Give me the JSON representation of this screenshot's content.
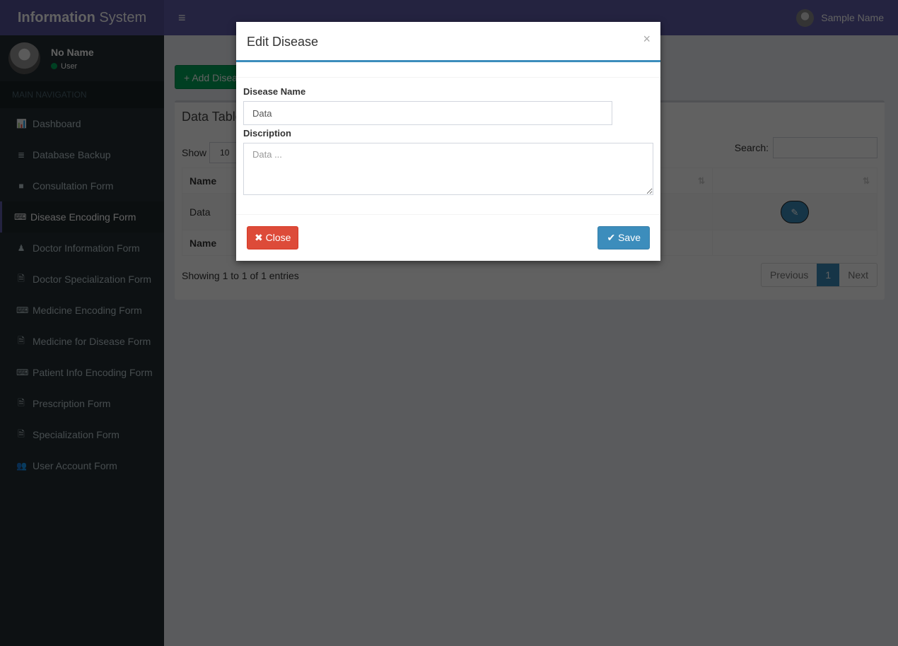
{
  "header": {
    "logo_bold": "Information",
    "logo_rest": " System",
    "toggle_icon": "≡",
    "user_name": "Sample Name"
  },
  "sidebar": {
    "user": {
      "name": "No Name",
      "status": "User"
    },
    "nav_header": "MAIN NAVIGATION",
    "items": [
      {
        "label": "Dashboard",
        "icon": "bar-chart-icon",
        "glyph": "📊"
      },
      {
        "label": "Database Backup",
        "icon": "database-icon",
        "glyph": "≣"
      },
      {
        "label": "Consultation Form",
        "icon": "folder-icon",
        "glyph": "■"
      },
      {
        "label": "Disease Encoding Form",
        "icon": "keyboard-icon",
        "glyph": "⌨",
        "active": true
      },
      {
        "label": "Doctor Information Form",
        "icon": "user-md-icon",
        "glyph": "♟"
      },
      {
        "label": "Doctor Specialization Form",
        "icon": "file-text-icon",
        "glyph": "🗎"
      },
      {
        "label": "Medicine Encoding Form",
        "icon": "keyboard-icon",
        "glyph": "⌨"
      },
      {
        "label": "Medicine for Disease Form",
        "icon": "file-text-icon",
        "glyph": "🗎"
      },
      {
        "label": "Patient Info Encoding Form",
        "icon": "keyboard-icon",
        "glyph": "⌨"
      },
      {
        "label": "Prescription Form",
        "icon": "file-text-icon",
        "glyph": "🗎"
      },
      {
        "label": "Specialization Form",
        "icon": "file-text-icon",
        "glyph": "🗎"
      },
      {
        "label": "User Account Form",
        "icon": "users-icon",
        "glyph": "👥"
      }
    ]
  },
  "main": {
    "add_button": "Add Disease",
    "add_icon": "+",
    "box_title": "Data Table",
    "show_label": "Show",
    "page_length": "10",
    "search_label": "Search:",
    "table": {
      "headers": [
        "Name",
        "",
        ""
      ],
      "rows": [
        [
          "Data",
          "",
          ""
        ]
      ],
      "footer": [
        "Name",
        "",
        ""
      ],
      "sort_icon": "⇅",
      "edit_icon": "✎"
    },
    "info": "Showing 1 to 1 of 1 entries",
    "pagination": {
      "previous": "Previous",
      "current": "1",
      "next": "Next"
    }
  },
  "modal": {
    "title": "Edit Disease",
    "close_x": "×",
    "disease_name_label": "Disease Name",
    "disease_name_value": "Data",
    "description_label": "Discription",
    "description_placeholder": "Data ...",
    "close_button": "Close",
    "close_icon": "✖",
    "save_button": "Save",
    "save_icon": "✔"
  },
  "colors": {
    "header": "#605ca8",
    "sidebar": "#222d32",
    "success": "#00a65a",
    "danger": "#dd4b39",
    "primary": "#3c8dbc"
  }
}
